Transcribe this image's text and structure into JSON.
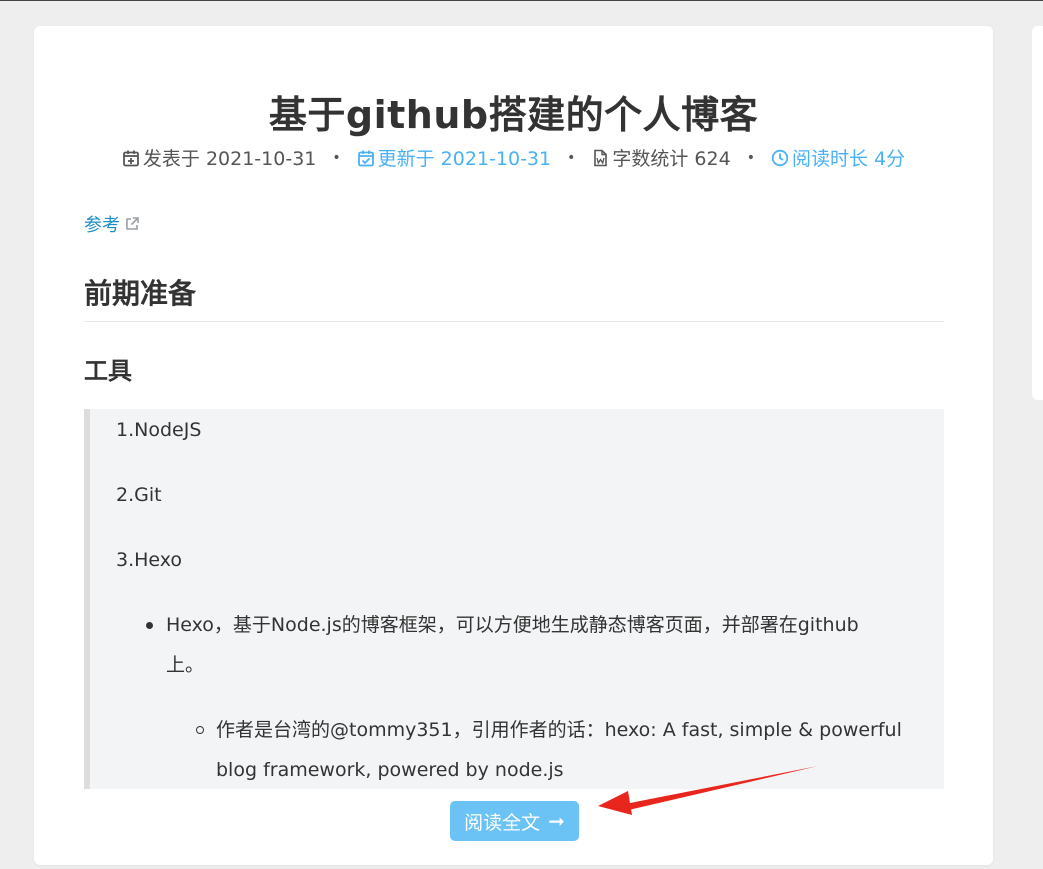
{
  "post": {
    "title": "基于github搭建的个人博客",
    "meta": {
      "published_label": "发表于 2021-10-31",
      "updated_label": "更新于 2021-10-31",
      "wordcount_label": "字数统计 624",
      "reading_label": "阅读时长 4分",
      "separator": "•"
    },
    "ref_link": "参考",
    "section_title": "前期准备",
    "subsection_title": "工具",
    "quote": {
      "items": [
        "1.NodeJS",
        "2.Git",
        "3.Hexo"
      ],
      "bullet_line1": "Hexo，基于Node.js的博客框架，可以方便地生成静态博客页面，并部署在github",
      "bullet_line2": "上。",
      "sub_line1": "作者是台湾的@tommy351，引用作者的话：hexo: A fast, simple & powerful",
      "sub_line2": "blog framework, powered by node.js"
    },
    "read_more_label": "阅读全文",
    "read_more_arrow": "➞"
  },
  "colors": {
    "accent": "#49b1f5",
    "button": "#6ac2f5",
    "annotation_arrow": "#e8261e"
  }
}
